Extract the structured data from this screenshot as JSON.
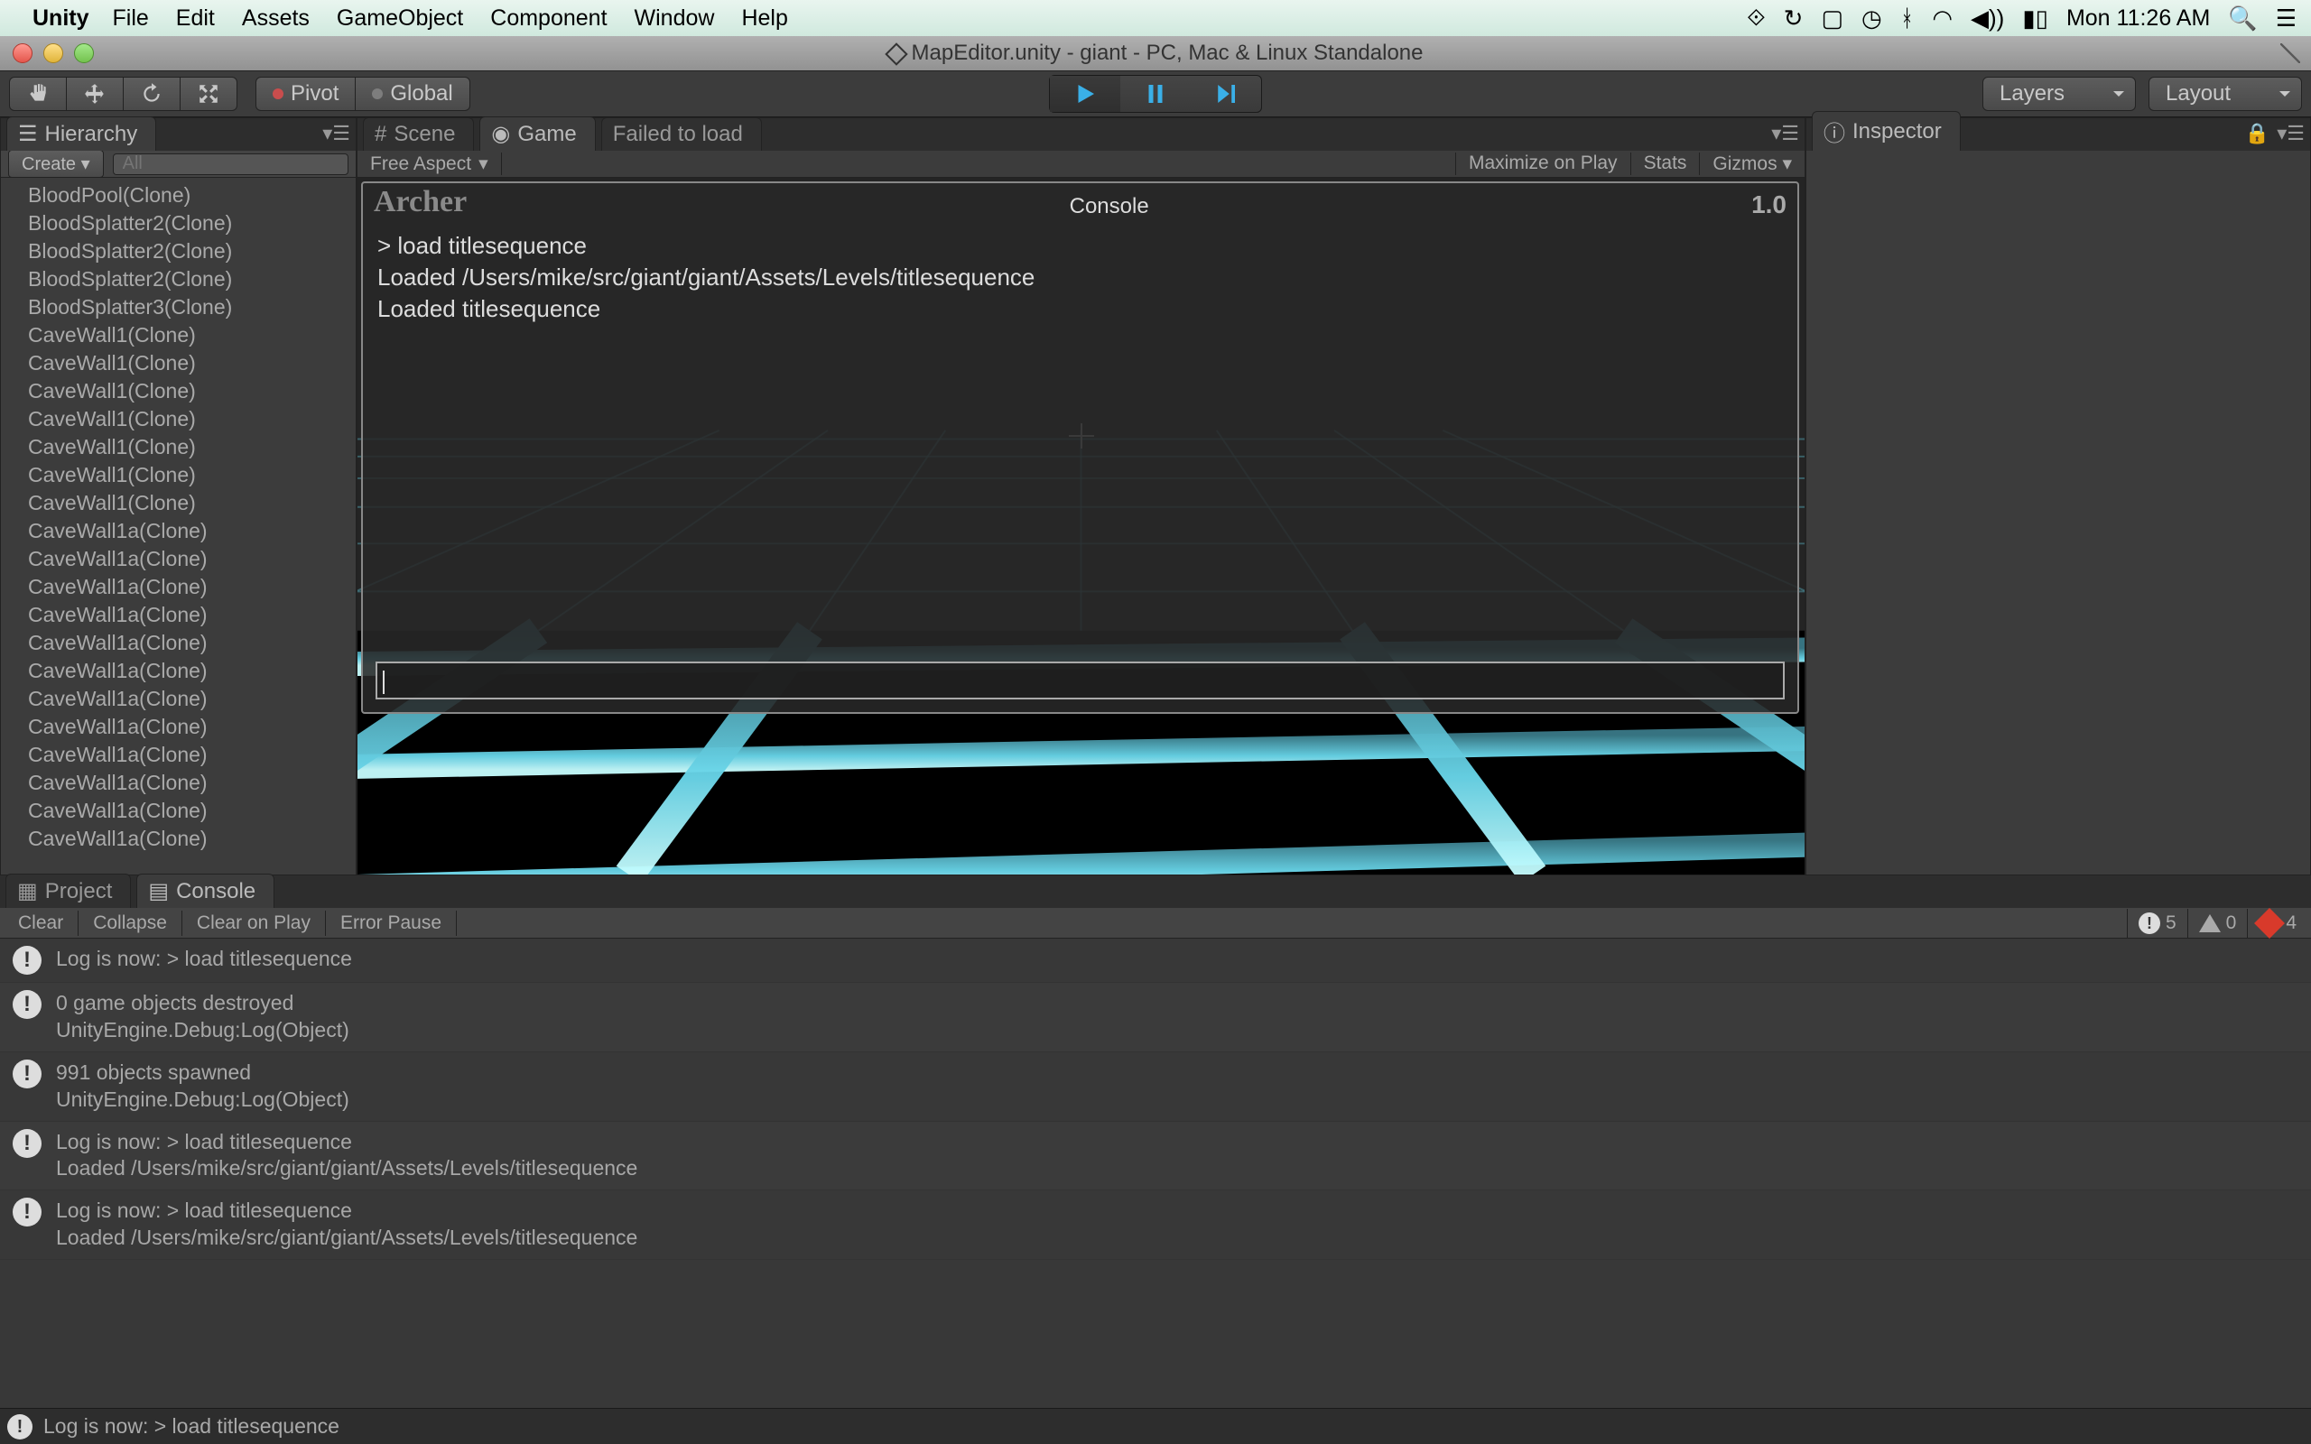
{
  "menubar": {
    "app": "Unity",
    "items": [
      "File",
      "Edit",
      "Assets",
      "GameObject",
      "Component",
      "Window",
      "Help"
    ],
    "clock": "Mon 11:26 AM"
  },
  "window": {
    "title": "MapEditor.unity - giant - PC, Mac & Linux Standalone"
  },
  "toolbar": {
    "pivot": "Pivot",
    "global": "Global",
    "layers": "Layers",
    "layout": "Layout"
  },
  "hierarchy": {
    "tab": "Hierarchy",
    "create": "Create",
    "searchPlaceholder": "All",
    "items": [
      "BloodPool(Clone)",
      "BloodSplatter2(Clone)",
      "BloodSplatter2(Clone)",
      "BloodSplatter2(Clone)",
      "BloodSplatter3(Clone)",
      "CaveWall1(Clone)",
      "CaveWall1(Clone)",
      "CaveWall1(Clone)",
      "CaveWall1(Clone)",
      "CaveWall1(Clone)",
      "CaveWall1(Clone)",
      "CaveWall1(Clone)",
      "CaveWall1a(Clone)",
      "CaveWall1a(Clone)",
      "CaveWall1a(Clone)",
      "CaveWall1a(Clone)",
      "CaveWall1a(Clone)",
      "CaveWall1a(Clone)",
      "CaveWall1a(Clone)",
      "CaveWall1a(Clone)",
      "CaveWall1a(Clone)",
      "CaveWall1a(Clone)",
      "CaveWall1a(Clone)",
      "CaveWall1a(Clone)"
    ]
  },
  "center": {
    "scene": "Scene",
    "game": "Game",
    "failed": "Failed to load",
    "aspect": "Free Aspect",
    "maxplay": "Maximize on Play",
    "stats": "Stats",
    "gizmos": "Gizmos"
  },
  "overlay": {
    "name": "Archer",
    "title": "Console",
    "version": "1.0",
    "lines": [
      "> load titlesequence",
      "Loaded /Users/mike/src/giant/giant/Assets/Levels/titlesequence",
      "Loaded titlesequence"
    ]
  },
  "inspector": {
    "tab": "Inspector"
  },
  "bottom": {
    "project": "Project",
    "console": "Console",
    "clear": "Clear",
    "collapse": "Collapse",
    "clearOnPlay": "Clear on Play",
    "errorPause": "Error Pause",
    "infoCount": "5",
    "warnCount": "0",
    "errCount": "4",
    "entries": [
      {
        "l1": "Log is now: > load titlesequence",
        "l2": ""
      },
      {
        "l1": "0 game objects destroyed",
        "l2": "UnityEngine.Debug:Log(Object)"
      },
      {
        "l1": "991 objects spawned",
        "l2": "UnityEngine.Debug:Log(Object)"
      },
      {
        "l1": "Log is now: > load titlesequence",
        "l2": "Loaded /Users/mike/src/giant/giant/Assets/Levels/titlesequence"
      },
      {
        "l1": "Log is now: > load titlesequence",
        "l2": "Loaded /Users/mike/src/giant/giant/Assets/Levels/titlesequence"
      }
    ]
  },
  "status": "Log is now: > load titlesequence"
}
